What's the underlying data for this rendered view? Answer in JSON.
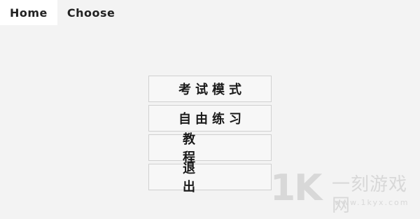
{
  "menubar": {
    "items": [
      {
        "label": "Home",
        "active": true
      },
      {
        "label": "Choose",
        "active": false
      }
    ]
  },
  "main_menu": {
    "exam_mode": "考试模式",
    "free_practice": "自由练习",
    "tutorial": "教程",
    "exit": "退出"
  },
  "watermark": {
    "logo": "1K",
    "site_name": "一刻游戏网",
    "url": "www.1kyx.com"
  }
}
